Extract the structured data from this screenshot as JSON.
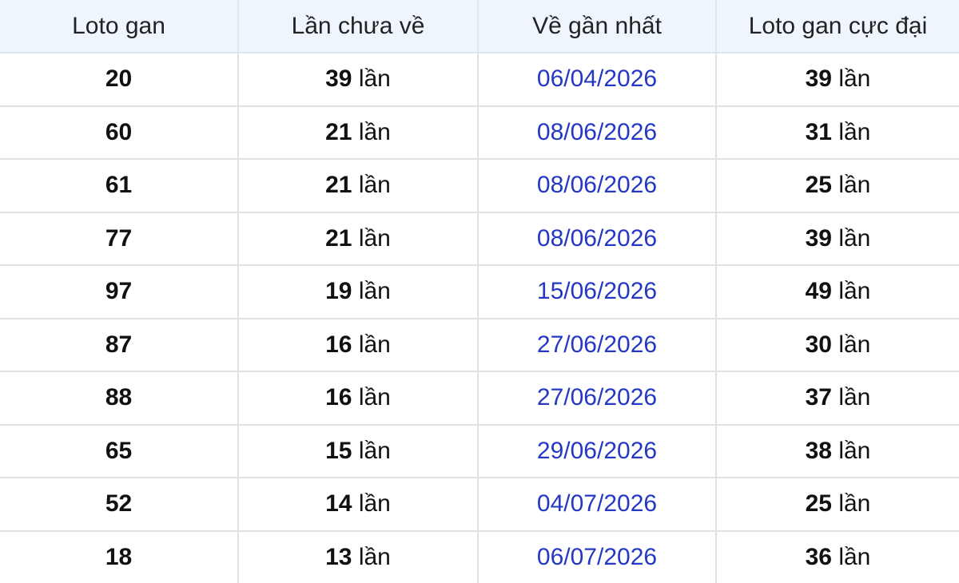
{
  "table": {
    "headers": [
      "Loto gan",
      "Lần chưa về",
      "Về gần nhất",
      "Loto gan cực đại"
    ],
    "unit": "lần",
    "rows": [
      {
        "number": "20",
        "missed": "39",
        "last_date": "06/04/2026",
        "max_gap": "39"
      },
      {
        "number": "60",
        "missed": "21",
        "last_date": "08/06/2026",
        "max_gap": "31"
      },
      {
        "number": "61",
        "missed": "21",
        "last_date": "08/06/2026",
        "max_gap": "25"
      },
      {
        "number": "77",
        "missed": "21",
        "last_date": "08/06/2026",
        "max_gap": "39"
      },
      {
        "number": "97",
        "missed": "19",
        "last_date": "15/06/2026",
        "max_gap": "49"
      },
      {
        "number": "87",
        "missed": "16",
        "last_date": "27/06/2026",
        "max_gap": "30"
      },
      {
        "number": "88",
        "missed": "16",
        "last_date": "27/06/2026",
        "max_gap": "37"
      },
      {
        "number": "65",
        "missed": "15",
        "last_date": "29/06/2026",
        "max_gap": "38"
      },
      {
        "number": "52",
        "missed": "14",
        "last_date": "04/07/2026",
        "max_gap": "25"
      },
      {
        "number": "18",
        "missed": "13",
        "last_date": "06/07/2026",
        "max_gap": "36"
      }
    ]
  },
  "colors": {
    "header_bg": "#eef5fd",
    "date_link": "#2438c4",
    "border": "#e2e2e2"
  }
}
